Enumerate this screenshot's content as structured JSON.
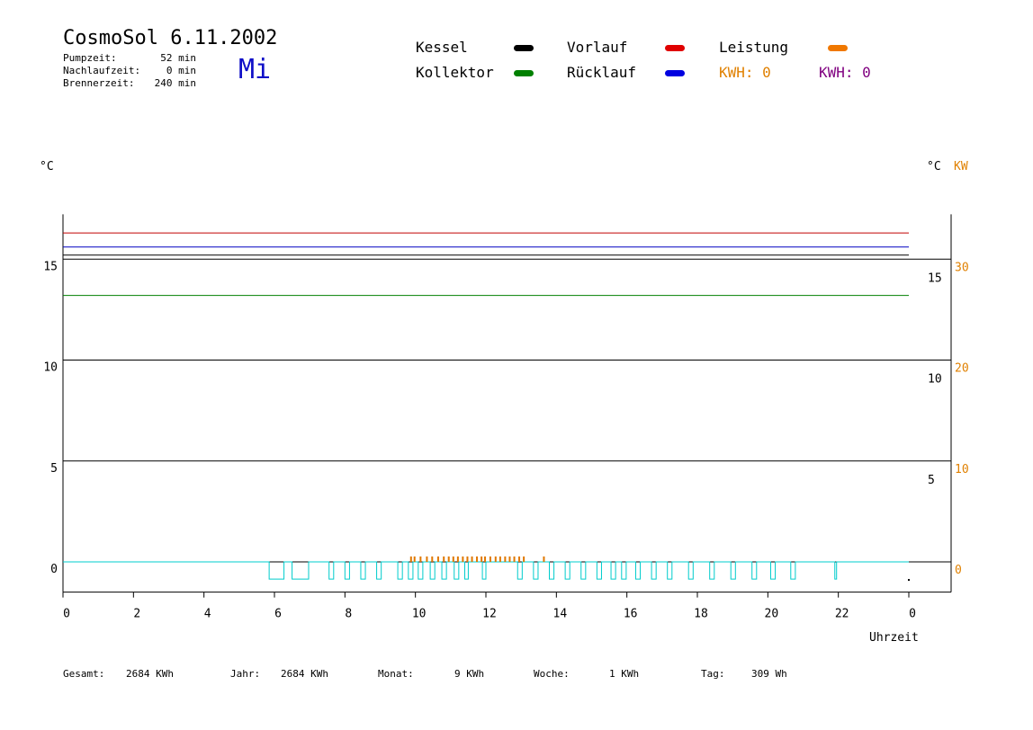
{
  "header": {
    "title": "CosmoSol 6.11.2002",
    "day": "Mi",
    "stats": [
      {
        "label": "Pumpzeit:",
        "value": "52 min"
      },
      {
        "label": "Nachlaufzeit:",
        "value": "0 min"
      },
      {
        "label": "Brennerzeit:",
        "value": "240 min"
      }
    ]
  },
  "legend": {
    "items": [
      {
        "label": "Kessel",
        "color": "#000000"
      },
      {
        "label": "Vorlauf",
        "color": "#e00000"
      },
      {
        "label": "Leistung",
        "color": "#f07800"
      },
      {
        "label": "Kollektor",
        "color": "#008000"
      },
      {
        "label": "Rücklauf",
        "color": "#0000e0"
      }
    ],
    "kwh": [
      {
        "text": "KWH: 0",
        "color": "#e08000"
      },
      {
        "text": "KWH: 0",
        "color": "#800080"
      }
    ]
  },
  "axes": {
    "left_unit": "°C",
    "right_unit_c": "°C",
    "right_unit_kw": "KW",
    "xlabel": "Uhrzeit"
  },
  "footer": [
    {
      "label": "Gesamt:",
      "value": "2684 KWh"
    },
    {
      "label": "Jahr:",
      "value": "2684 KWh"
    },
    {
      "label": "Monat:",
      "value": "9 KWh"
    },
    {
      "label": "Woche:",
      "value": "1 KWh"
    },
    {
      "label": "Tag:",
      "value": "309 Wh"
    }
  ],
  "chart_data": {
    "type": "line",
    "title": "CosmoSol 6.11.2002",
    "xlabel": "Uhrzeit",
    "ylabel": "°C",
    "xlim": [
      0,
      24
    ],
    "ylim": [
      -1.5,
      17
    ],
    "x_ticks": [
      0,
      2,
      4,
      6,
      8,
      10,
      12,
      14,
      16,
      18,
      20,
      22,
      0
    ],
    "y_ticks_left": [
      0,
      5,
      10,
      15
    ],
    "y_ticks_right_c": [
      5,
      10,
      15
    ],
    "y_ticks_right_kw": [
      0,
      10,
      20,
      30
    ],
    "grid": true,
    "series": [
      {
        "name": "Vorlauf",
        "color": "#c00000",
        "x": [
          0,
          24
        ],
        "y": [
          16.3,
          16.3
        ]
      },
      {
        "name": "Rücklauf",
        "color": "#0000c0",
        "x": [
          0,
          24
        ],
        "y": [
          15.6,
          15.6
        ]
      },
      {
        "name": "Kessel",
        "color": "#000000",
        "x": [
          0,
          24
        ],
        "y": [
          15.2,
          15.2
        ]
      },
      {
        "name": "Kollektor",
        "color": "#008000",
        "x": [
          0,
          24
        ],
        "y": [
          13.2,
          13.2
        ]
      }
    ],
    "pump_color": "#00cccc",
    "pump_on_intervals": [
      [
        5.85,
        6.27
      ],
      [
        6.5,
        6.97
      ],
      [
        7.55,
        7.68
      ],
      [
        8.0,
        8.13
      ],
      [
        8.45,
        8.58
      ],
      [
        8.9,
        9.03
      ],
      [
        9.5,
        9.63
      ],
      [
        9.8,
        9.93
      ],
      [
        10.08,
        10.21
      ],
      [
        10.42,
        10.55
      ],
      [
        10.75,
        10.88
      ],
      [
        11.1,
        11.23
      ],
      [
        11.4,
        11.5
      ],
      [
        11.9,
        12.0
      ],
      [
        12.9,
        13.03
      ],
      [
        13.35,
        13.48
      ],
      [
        13.8,
        13.93
      ],
      [
        14.25,
        14.38
      ],
      [
        14.7,
        14.83
      ],
      [
        15.15,
        15.28
      ],
      [
        15.55,
        15.68
      ],
      [
        15.85,
        15.98
      ],
      [
        16.25,
        16.38
      ],
      [
        16.7,
        16.83
      ],
      [
        17.15,
        17.28
      ],
      [
        17.75,
        17.88
      ],
      [
        18.35,
        18.48
      ],
      [
        18.95,
        19.08
      ],
      [
        19.55,
        19.68
      ],
      [
        20.08,
        20.21
      ],
      [
        20.65,
        20.78
      ],
      [
        21.9,
        21.95
      ]
    ],
    "leistung_color": "#e07800",
    "leistung_spikes_x": [
      9.85,
      9.95,
      10.12,
      10.3,
      10.45,
      10.62,
      10.78,
      10.92,
      11.05,
      11.18,
      11.32,
      11.45,
      11.58,
      11.72,
      11.85,
      11.95,
      12.1,
      12.25,
      12.38,
      12.52,
      12.65,
      12.78,
      12.92,
      13.05,
      13.62
    ]
  }
}
